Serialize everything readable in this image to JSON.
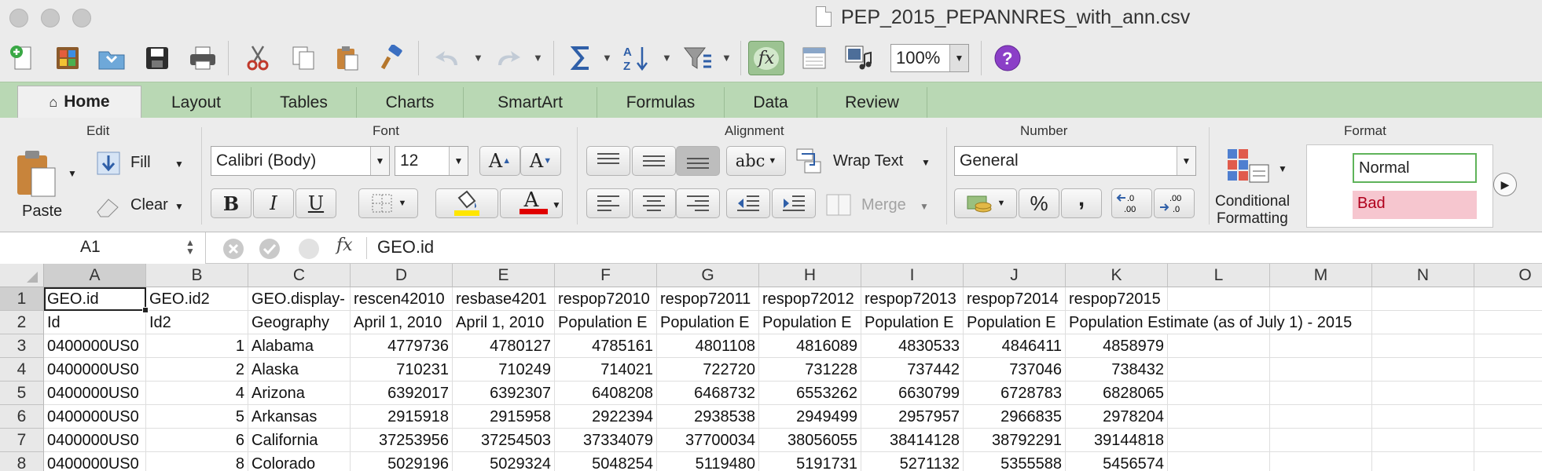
{
  "window": {
    "title": "PEP_2015_PEPANNRES_with_ann.csv"
  },
  "toolbar": {
    "zoom": "100%"
  },
  "ribbon_tabs": [
    "Home",
    "Layout",
    "Tables",
    "Charts",
    "SmartArt",
    "Formulas",
    "Data",
    "Review"
  ],
  "ribbon": {
    "groups": {
      "edit": "Edit",
      "font": "Font",
      "alignment": "Alignment",
      "number": "Number",
      "format": "Format"
    },
    "paste": "Paste",
    "fill": "Fill",
    "clear": "Clear",
    "font_name": "Calibri (Body)",
    "font_size": "12",
    "bold": "B",
    "italic": "I",
    "underline": "U",
    "font_color_glyph": "A",
    "grow_font": "A",
    "shrink_font": "A",
    "abc": "abc",
    "wrap_text": "Wrap Text",
    "merge": "Merge",
    "number_format": "General",
    "percent": "%",
    "comma": ",",
    "inc_decimal": ".0\n.00",
    "dec_decimal": ".00\n.0",
    "conditional_formatting_l1": "Conditional",
    "conditional_formatting_l2": "Formatting",
    "style_normal": "Normal",
    "style_bad": "Bad"
  },
  "formula_bar": {
    "name_box": "A1",
    "fx": "fx",
    "content": "GEO.id"
  },
  "sheet": {
    "columns": [
      "A",
      "B",
      "C",
      "D",
      "E",
      "F",
      "G",
      "H",
      "I",
      "J",
      "K",
      "L",
      "M",
      "N",
      "O"
    ],
    "rows": [
      {
        "n": "1",
        "cells": [
          "GEO.id",
          "GEO.id2",
          "GEO.display-",
          "rescen42010",
          "resbase4201",
          "respop72010",
          "respop72011",
          "respop72012",
          "respop72013",
          "respop72014",
          "respop72015"
        ]
      },
      {
        "n": "2",
        "cells": [
          "Id",
          "Id2",
          "Geography",
          "April 1, 2010",
          "April 1, 2010",
          "Population E",
          "Population E",
          "Population E",
          "Population E",
          "Population E",
          "Population Estimate (as of July 1) - 2015"
        ]
      },
      {
        "n": "3",
        "cells": [
          "0400000US0",
          "1",
          "Alabama",
          "4779736",
          "4780127",
          "4785161",
          "4801108",
          "4816089",
          "4830533",
          "4846411",
          "4858979"
        ]
      },
      {
        "n": "4",
        "cells": [
          "0400000US0",
          "2",
          "Alaska",
          "710231",
          "710249",
          "714021",
          "722720",
          "731228",
          "737442",
          "737046",
          "738432"
        ]
      },
      {
        "n": "5",
        "cells": [
          "0400000US0",
          "4",
          "Arizona",
          "6392017",
          "6392307",
          "6408208",
          "6468732",
          "6553262",
          "6630799",
          "6728783",
          "6828065"
        ]
      },
      {
        "n": "6",
        "cells": [
          "0400000US0",
          "5",
          "Arkansas",
          "2915918",
          "2915958",
          "2922394",
          "2938538",
          "2949499",
          "2957957",
          "2966835",
          "2978204"
        ]
      },
      {
        "n": "7",
        "cells": [
          "0400000US0",
          "6",
          "California",
          "37253956",
          "37254503",
          "37334079",
          "37700034",
          "38056055",
          "38414128",
          "38792291",
          "39144818"
        ]
      },
      {
        "n": "8",
        "cells": [
          "0400000US0",
          "8",
          "Colorado",
          "5029196",
          "5029324",
          "5048254",
          "5119480",
          "5191731",
          "5271132",
          "5355588",
          "5456574"
        ]
      }
    ]
  }
}
